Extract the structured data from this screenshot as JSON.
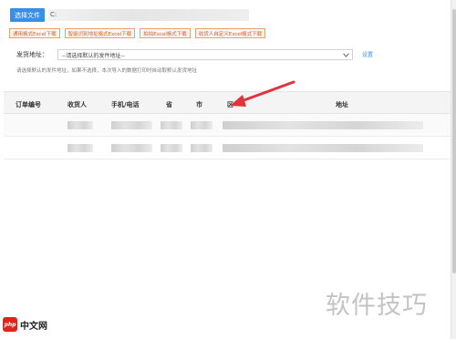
{
  "file": {
    "select_label": "选择文件",
    "path_value": "C:"
  },
  "downloads": [
    {
      "label": "通用格式Excel下载"
    },
    {
      "label": "智能识别地址格式Excel下载"
    },
    {
      "label": "拍拍Excel格式下载"
    },
    {
      "label": "收货人自定义Excel格式下载"
    }
  ],
  "address": {
    "label": "发货地址：",
    "selected": "--请选择默认的发件地址--",
    "settings_label": "设置",
    "hint": "请选择默认的发件地址，如果不选择，本次导入的数据打印时自动取默认发货地址"
  },
  "table": {
    "columns": [
      "订单编号",
      "收货人",
      "手机/电话",
      "省",
      "市",
      "区",
      "地址"
    ],
    "rows": [
      {
        "blurred": true
      },
      {
        "blurred": true
      }
    ]
  },
  "watermark": {
    "logo_text": "php",
    "site_text": "中文网",
    "brand_text": "软件技巧"
  },
  "colors": {
    "primary": "#3a8ee6",
    "download_border": "#e8a070",
    "annotation_arrow": "#e0343a"
  }
}
